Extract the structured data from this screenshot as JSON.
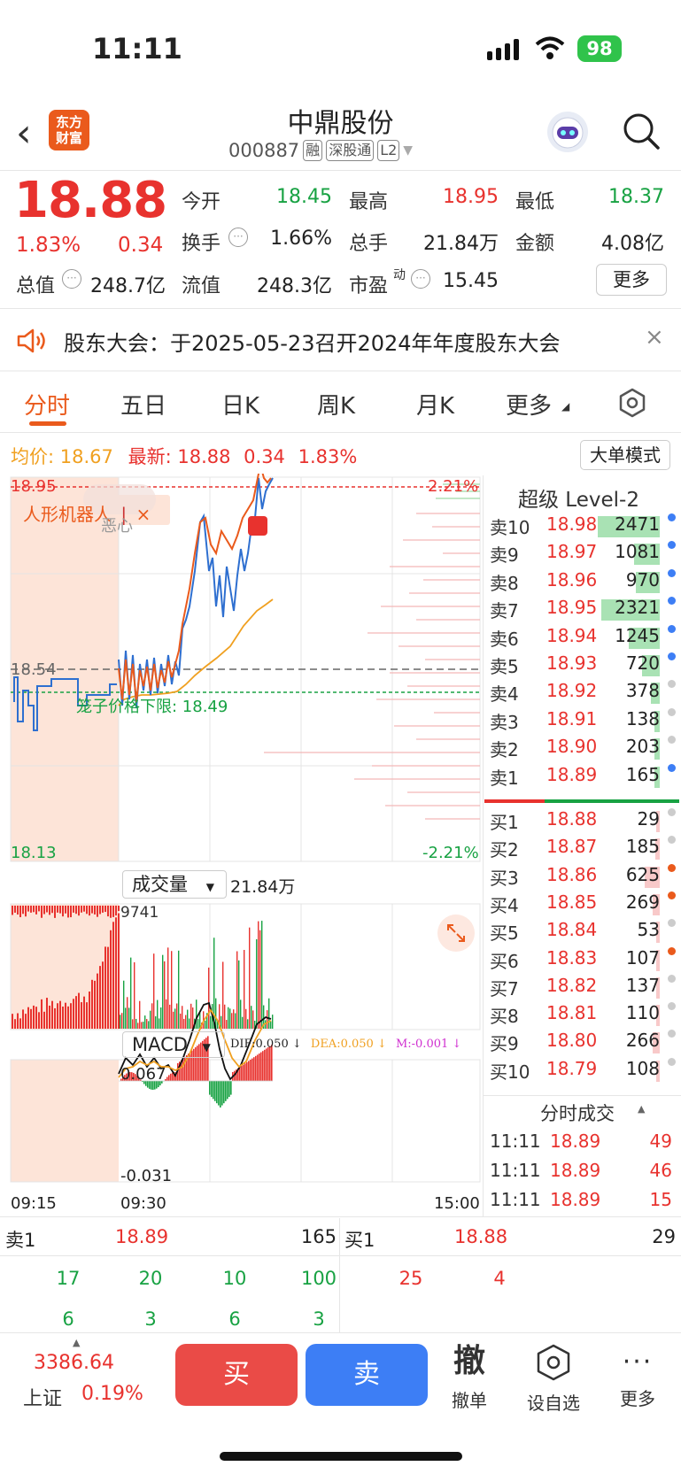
{
  "status": {
    "time": "11:11",
    "battery": "98"
  },
  "header": {
    "logo": [
      "东方",
      "财富"
    ],
    "name": "中鼎股份",
    "code": "000887",
    "tags": [
      "融",
      "深股通",
      "L2"
    ]
  },
  "quote": {
    "price": "18.88",
    "pct": "1.83%",
    "change": "0.34",
    "open_label": "今开",
    "open": "18.45",
    "high_label": "最高",
    "high": "18.95",
    "low_label": "最低",
    "low": "18.37",
    "turnover_label": "换手",
    "turnover": "1.66%",
    "volume_label": "总手",
    "volume": "21.84万",
    "amount_label": "金额",
    "amount": "4.08亿",
    "mktcap_label": "总值",
    "mktcap": "248.7亿",
    "float_label": "流值",
    "float": "248.3亿",
    "pe_label": "市盈",
    "pe_sup": "动",
    "pe": "15.45",
    "more": "更多"
  },
  "notice": {
    "text": "股东大会：于2025-05-23召开2024年年度股东大会",
    "close": "×"
  },
  "tabs": [
    "分时",
    "五日",
    "日K",
    "周K",
    "月K",
    "更多"
  ],
  "chart": {
    "avg_label": "均价:",
    "avg": "18.67",
    "latest_label": "最新:",
    "latest": "18.88",
    "latest_chg": "0.34",
    "latest_pct": "1.83%",
    "big_order": "大单模式",
    "top_price": "18.95",
    "top_pct": "2.21%",
    "mid_price": "18.54",
    "bottom_price": "18.13",
    "bottom_pct": "-2.21%",
    "limit_label": "笼子价格下限: 18.49",
    "concept_tag": "人形机器人",
    "concept_close": "×",
    "bubble_tag": "恶心",
    "b_marker": "B",
    "vol_selector": "成交量",
    "vol_total": "21.84万",
    "vol_max": "9741",
    "macd_selector": "MACD",
    "dif": "DIF:0.050 ↓",
    "dea": "DEA:0.050 ↓",
    "m": "M:-0.001 ↓",
    "macd_max": "0.067",
    "macd_min": "-0.031",
    "t_start": "09:15",
    "t_open": "09:30",
    "t_end": "15:00"
  },
  "level2": {
    "title": "超级 Level-2",
    "asks": [
      {
        "label": "卖10",
        "price": "18.98",
        "vol": "2471",
        "fill": 1.0,
        "dot": "#3d7ef5"
      },
      {
        "label": "卖9",
        "price": "18.97",
        "vol": "1081",
        "fill": 0.42,
        "dot": "#3d7ef5"
      },
      {
        "label": "卖8",
        "price": "18.96",
        "vol": "970",
        "fill": 0.38,
        "dot": "#3d7ef5"
      },
      {
        "label": "卖7",
        "price": "18.95",
        "vol": "2321",
        "fill": 0.94,
        "dot": "#3d7ef5"
      },
      {
        "label": "卖6",
        "price": "18.94",
        "vol": "1245",
        "fill": 0.5,
        "dot": "#3d7ef5"
      },
      {
        "label": "卖5",
        "price": "18.93",
        "vol": "720",
        "fill": 0.28,
        "dot": "#3d7ef5"
      },
      {
        "label": "卖4",
        "price": "18.92",
        "vol": "378",
        "fill": 0.15,
        "dot": "#cccccc"
      },
      {
        "label": "卖3",
        "price": "18.91",
        "vol": "138",
        "fill": 0.06,
        "dot": "#cccccc"
      },
      {
        "label": "卖2",
        "price": "18.90",
        "vol": "203",
        "fill": 0.08,
        "dot": "#cccccc"
      },
      {
        "label": "卖1",
        "price": "18.89",
        "vol": "165",
        "fill": 0.07,
        "dot": "#3d7ef5"
      }
    ],
    "bids": [
      {
        "label": "买1",
        "price": "18.88",
        "vol": "29",
        "fill": 0.03,
        "dot": "#cccccc"
      },
      {
        "label": "买2",
        "price": "18.87",
        "vol": "185",
        "fill": 0.07,
        "dot": "#cccccc"
      },
      {
        "label": "买3",
        "price": "18.86",
        "vol": "625",
        "fill": 0.25,
        "dot": "#ea5a1c"
      },
      {
        "label": "买4",
        "price": "18.85",
        "vol": "269",
        "fill": 0.11,
        "dot": "#ea5a1c"
      },
      {
        "label": "买5",
        "price": "18.84",
        "vol": "53",
        "fill": 0.03,
        "dot": "#cccccc"
      },
      {
        "label": "买6",
        "price": "18.83",
        "vol": "107",
        "fill": 0.05,
        "dot": "#ea5a1c"
      },
      {
        "label": "买7",
        "price": "18.82",
        "vol": "137",
        "fill": 0.06,
        "dot": "#cccccc"
      },
      {
        "label": "买8",
        "price": "18.81",
        "vol": "110",
        "fill": 0.05,
        "dot": "#cccccc"
      },
      {
        "label": "买9",
        "price": "18.80",
        "vol": "266",
        "fill": 0.11,
        "dot": "#cccccc"
      },
      {
        "label": "买10",
        "price": "18.79",
        "vol": "108",
        "fill": 0.05,
        "dot": "#cccccc"
      }
    ]
  },
  "ticks": {
    "title": "分时成交",
    "rows": [
      {
        "time": "11:11",
        "price": "18.89",
        "vol": "49"
      },
      {
        "time": "11:11",
        "price": "18.89",
        "vol": "46"
      },
      {
        "time": "11:11",
        "price": "18.89",
        "vol": "15"
      }
    ]
  },
  "level1": {
    "ask_label": "卖1",
    "ask_price": "18.89",
    "ask_vol": "165",
    "bid_label": "买1",
    "bid_price": "18.88",
    "bid_vol": "29",
    "ask_queue": [
      [
        "17",
        "20",
        "10",
        "100"
      ],
      [
        "6",
        "3",
        "6",
        "3"
      ]
    ],
    "bid_queue": [
      "25",
      "4"
    ]
  },
  "footer": {
    "index_value": "3386.64",
    "index_name": "上证",
    "index_pct": "0.19%",
    "buy": "买",
    "sell": "卖",
    "cancel_icon": "撤",
    "cancel": "撤单",
    "watch": "设自选",
    "more": "更多"
  }
}
